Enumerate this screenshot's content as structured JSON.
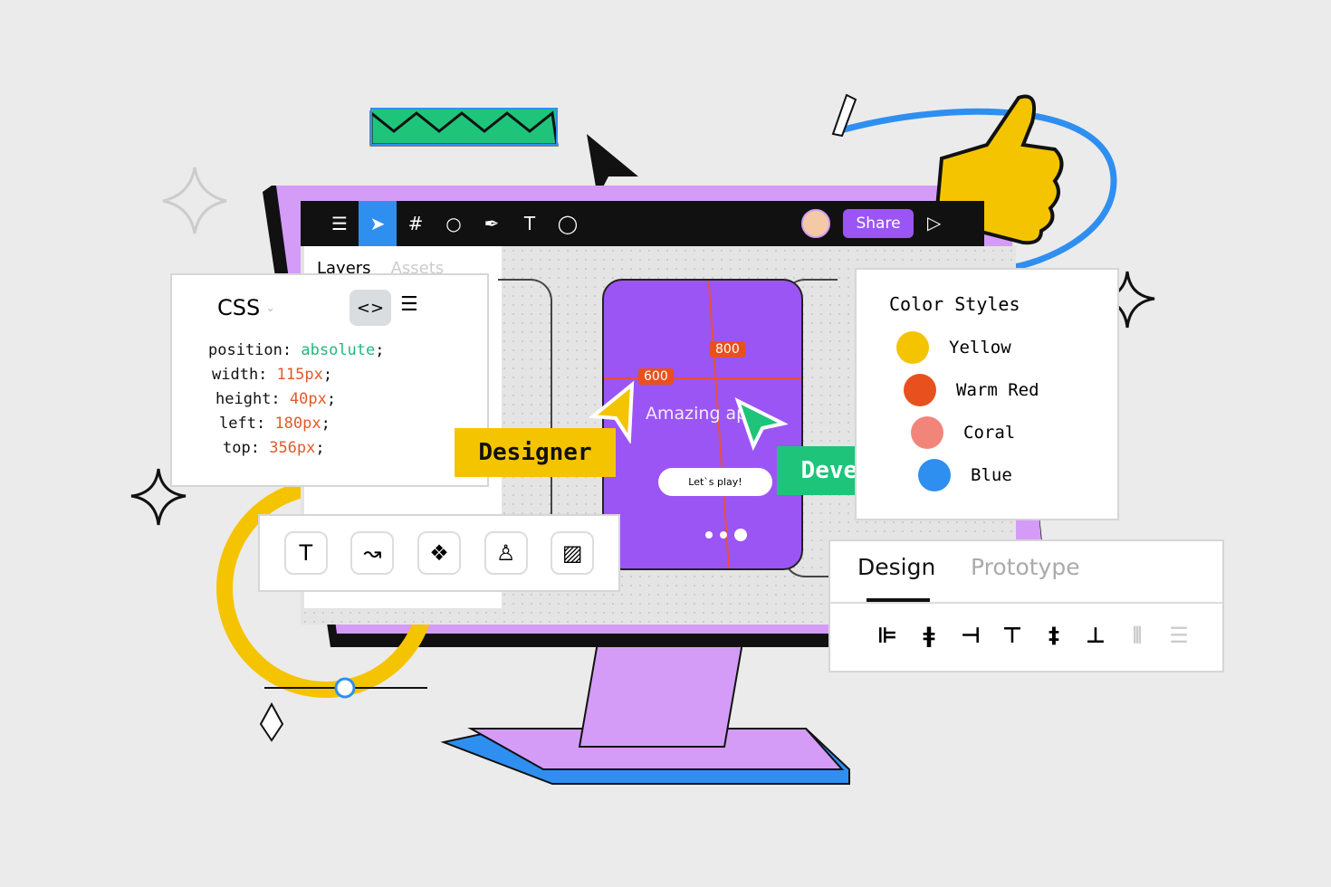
{
  "toolbar": {
    "icons": [
      "menu-icon",
      "cursor-icon",
      "frame-icon",
      "ellipse-icon",
      "pen-icon",
      "text-icon",
      "comment-icon"
    ],
    "share_label": "Share",
    "play_icon": "play-icon"
  },
  "layers_panel": {
    "tabs": [
      "Layers",
      "Assets"
    ]
  },
  "css_panel": {
    "title": "CSS",
    "lines": [
      {
        "prop": "position:",
        "value": "absolute",
        "color": "#22b87a"
      },
      {
        "prop": "width:",
        "value": "115px",
        "color": "#e05a2b"
      },
      {
        "prop": "height:",
        "value": "40px",
        "color": "#e05a2b"
      },
      {
        "prop": "left:",
        "value": "180px",
        "color": "#e05a2b"
      },
      {
        "prop": "top:",
        "value": "356px",
        "color": "#e05a2b"
      }
    ]
  },
  "phone": {
    "guide_h": "600",
    "guide_v": "800",
    "title": "Amazing ap",
    "button": "Let`s play!"
  },
  "tags": {
    "designer": "Designer",
    "developer": "Developer"
  },
  "color_styles": {
    "title": "Color Styles",
    "items": [
      {
        "name": "Yellow",
        "color": "#f5c400"
      },
      {
        "name": "Warm Red",
        "color": "#e8501e"
      },
      {
        "name": "Coral",
        "color": "#f2857a"
      },
      {
        "name": "Blue",
        "color": "#2f8ff0"
      }
    ]
  },
  "design_panel": {
    "tabs": [
      "Design",
      "Prototype"
    ],
    "active_tab": "Design",
    "align_icons": [
      "align-left-icon",
      "align-center-h-icon",
      "align-right-icon",
      "align-top-icon",
      "align-center-v-icon",
      "align-bottom-icon",
      "distribute-h-icon",
      "distribute-v-icon"
    ]
  },
  "tools": [
    "text-tool-icon",
    "path-tool-icon",
    "component-icon",
    "stamp-icon",
    "image-icon"
  ],
  "colors": {
    "monitor": "#d49cf7",
    "phone": "#9b55f5",
    "accent_blue": "#2f8ff0",
    "yellow": "#f5c400",
    "green": "#1ec47a"
  }
}
